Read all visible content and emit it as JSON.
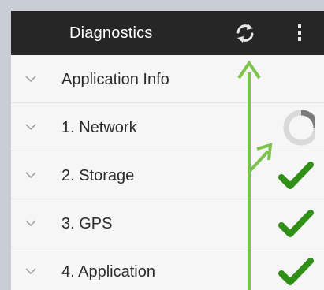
{
  "header": {
    "title": "Diagnostics"
  },
  "icons": {
    "refresh": "refresh-icon",
    "overflow": "overflow-menu-icon",
    "expand": "chevron-down-icon",
    "spinner": "loading-spinner-icon",
    "check": "checkmark-icon"
  },
  "list": {
    "items": [
      {
        "label": "Application Info",
        "status": "none"
      },
      {
        "label": "1. Network",
        "status": "loading"
      },
      {
        "label": "2. Storage",
        "status": "passed"
      },
      {
        "label": "3. GPS",
        "status": "passed"
      },
      {
        "label": "4. Application",
        "status": "passed"
      }
    ]
  },
  "colors": {
    "action_bar": "#262626",
    "check": "#2f8f16",
    "annotation_arrow": "#7cc24d"
  }
}
